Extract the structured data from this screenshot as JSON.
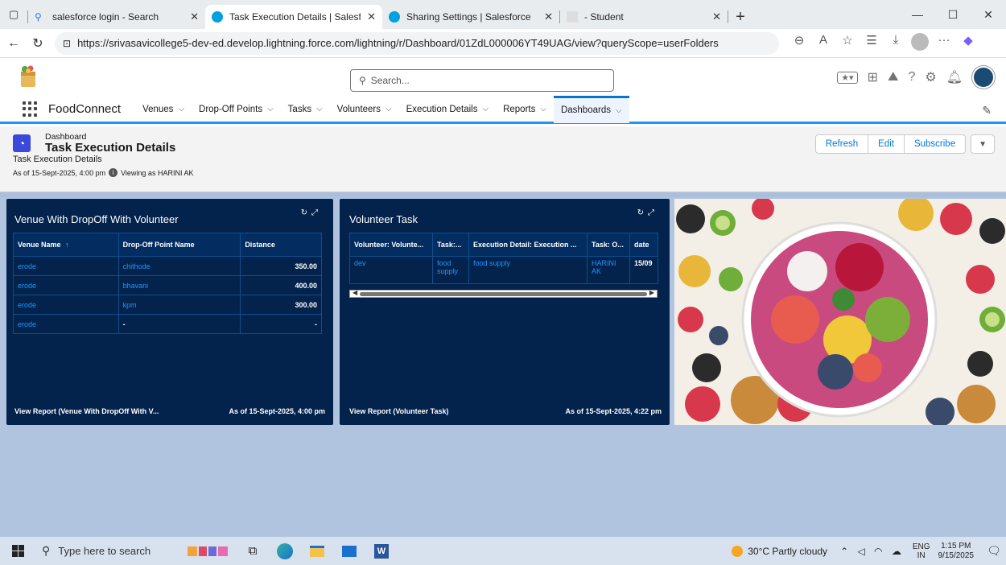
{
  "browser": {
    "tabs": [
      {
        "title": "salesforce login - Search",
        "active": false
      },
      {
        "title": "Task Execution Details | Salesforce",
        "active": true
      },
      {
        "title": "Sharing Settings | Salesforce",
        "active": false
      },
      {
        "title": "- Student",
        "active": false
      }
    ],
    "url": "https://srivasavicollege5-dev-ed.develop.lightning.force.com/lightning/r/Dashboard/01ZdL000006YT49UAG/view?queryScope=userFolders"
  },
  "sf": {
    "search_placeholder": "Search...",
    "app_name": "FoodConnect",
    "nav": [
      "Venues",
      "Drop-Off Points",
      "Tasks",
      "Volunteers",
      "Execution Details",
      "Reports",
      "Dashboards"
    ],
    "active_nav": "Dashboards"
  },
  "dashboard": {
    "type_label": "Dashboard",
    "title": "Task Execution Details",
    "subtitle": "Task Execution Details",
    "as_of": "As of 15-Sept-2025, 4:00 pm",
    "viewing_as": "Viewing as HARINI AK",
    "buttons": {
      "refresh": "Refresh",
      "edit": "Edit",
      "subscribe": "Subscribe"
    }
  },
  "widget1": {
    "title": "Venue With DropOff With Volunteer",
    "columns": [
      "Venue Name",
      "Drop-Off Point Name",
      "Distance"
    ],
    "sort_indicator": "↑",
    "rows": [
      [
        "erode",
        "chithode",
        "350.00"
      ],
      [
        "erode",
        "bhavani",
        "400.00"
      ],
      [
        "erode",
        "kpm",
        "300.00"
      ],
      [
        "erode",
        "-",
        "-"
      ]
    ],
    "view_report": "View Report (Venue With DropOff With V...",
    "as_of": "As of 15-Sept-2025, 4:00 pm"
  },
  "widget2": {
    "title": "Volunteer Task",
    "columns": [
      "Volunteer: Volunte...",
      "Task:...",
      "Execution Detail: Execution ...",
      "Task: O...",
      "date"
    ],
    "rows": [
      [
        "dev",
        "food supply",
        "food supply",
        "HARINI AK",
        "15/09"
      ]
    ],
    "view_report": "View Report (Volunteer Task)",
    "as_of": "As of 15-Sept-2025, 4:22 pm"
  },
  "taskbar": {
    "search_placeholder": "Type here to search",
    "weather": "30°C  Partly cloudy",
    "lang_top": "ENG",
    "lang_bottom": "IN",
    "time": "1:15 PM",
    "date": "9/15/2025"
  },
  "colors": {
    "widget_bg": "#03234d",
    "link_blue": "#1b96ff",
    "canvas_bg": "#b0c4df",
    "dashboard_icon": "#3a49da"
  }
}
